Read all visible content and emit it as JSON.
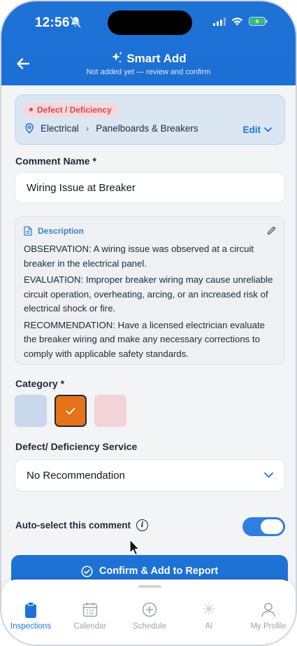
{
  "status": {
    "time": "12:56"
  },
  "header": {
    "title": "Smart Add",
    "subtitle": "Not added yet — review and confirm"
  },
  "summary": {
    "badge": "Defect / Deficiency",
    "system": "Electrical",
    "subsystem": "Panelboards & Breakers",
    "edit_label": "Edit"
  },
  "comment_name": {
    "label": "Comment Name *",
    "value": "Wiring Issue at Breaker"
  },
  "description": {
    "label": "Description",
    "observation": "OBSERVATION: A wiring issue was observed at a circuit breaker in the electrical panel.",
    "evaluation": "EVALUATION: Improper breaker wiring may cause unreliable circuit operation, overheating, arcing, or an increased risk of electrical shock or fire.",
    "recommendation": "RECOMMENDATION: Have a licensed electrician evaluate the breaker wiring and make any necessary corrections to comply with applicable safety standards."
  },
  "category": {
    "label": "Category *",
    "options": [
      {
        "color": "#c9d8ec",
        "selected": false
      },
      {
        "color": "#e67317",
        "selected": true
      },
      {
        "color": "#f2d3d8",
        "selected": false
      }
    ]
  },
  "service": {
    "label": "Defect/ Deficiency Service",
    "value": "No Recommendation"
  },
  "auto_select": {
    "label": "Auto-select this comment",
    "info_glyph": "i",
    "enabled": true
  },
  "confirm_label": "Confirm & Add to Report",
  "tabs": [
    {
      "label": "Inspections",
      "icon": "clipboard-icon",
      "active": true
    },
    {
      "label": "Calendar",
      "icon": "calendar-icon",
      "active": false
    },
    {
      "label": "Schedule",
      "icon": "plus-circle-icon",
      "active": false
    },
    {
      "label": "AI",
      "icon": "ai-sparkle-icon",
      "active": false
    },
    {
      "label": "My Profile",
      "icon": "person-icon",
      "active": false
    }
  ],
  "colors": {
    "primary": "#1e72d6",
    "defect": "#d24a57",
    "selected_category": "#e67317"
  }
}
